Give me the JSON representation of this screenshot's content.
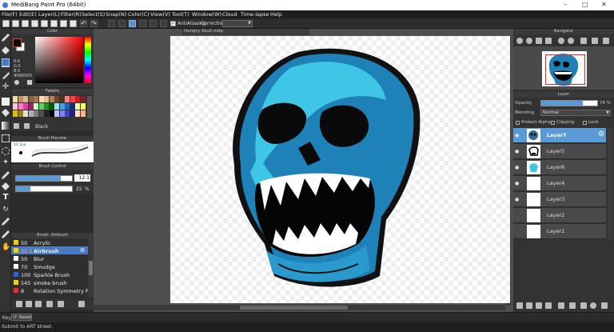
{
  "window": {
    "title": "MediBang Paint Pro (64bit)",
    "document_title": "Hungry Skull.mdp"
  },
  "menu": [
    "File(F)",
    "Edit(E)",
    "Layer(L)",
    "Filter(R)",
    "Select(S)",
    "Snap(N)",
    "Color(C)",
    "View(V)",
    "Tool(T)",
    "Window(W)",
    "Cloud",
    "Time-lapse",
    "Help"
  ],
  "toolbar": {
    "antialiasing_label": "AntiAliasing",
    "correction_label": "Correction"
  },
  "color_panel": {
    "title": "Color",
    "r": "R:6",
    "g": "G:5",
    "b": "B:5",
    "hex": "#060505",
    "foreground": "#060505",
    "background": "#ffffff"
  },
  "palette_panel": {
    "title": "Palette",
    "selected_name": "Black",
    "swatches": [
      "#f0e0a0",
      "#c09060",
      "#d8b898",
      "#8a6040",
      "#a07850",
      "#ffd8b0",
      "#e0c090",
      "#b08060",
      "#704828",
      "#503018",
      "#ff8080",
      "#ff4040",
      "#c02020",
      "#802020",
      "#ffc0e0",
      "#ff80c0",
      "#e040a0",
      "#a02070",
      "#c0ffc0",
      "#60d060",
      "#209020",
      "#006000",
      "#a0e0ff",
      "#40a0e0",
      "#2060c0",
      "#103080",
      "#ffffa0",
      "#ffff40",
      "#e0c000",
      "#a08000",
      "#e0e0e0",
      "#b0b0b0",
      "#808080",
      "#505050",
      "#202020",
      "#000000",
      "#c0c0ff",
      "#8080ff",
      "#4040c0",
      "#202080",
      "#ffe0c0",
      "#ffb080"
    ]
  },
  "brush_preview": {
    "title": "Brush Preview",
    "size_label": "12.1px"
  },
  "brush_control": {
    "title": "Brush Control",
    "size_value": "12.1",
    "opacity_value": "25",
    "opacity_unit": "%",
    "size_fraction": 0.8,
    "opacity_fraction": 0.25
  },
  "brush_list": {
    "title": "Brush: Airbrush",
    "items": [
      {
        "size": "50",
        "name": "Acrylic",
        "color": "#f5d000"
      },
      {
        "size": "12.1",
        "name": "Airbrush",
        "color": "#f5d000",
        "selected": true
      },
      {
        "size": "50",
        "name": "Blur",
        "color": "#ffffff"
      },
      {
        "size": "70",
        "name": "Smudge",
        "color": "#ffffff"
      },
      {
        "size": "100",
        "name": "Sparkle Brush",
        "color": "#3060e0"
      },
      {
        "size": "545",
        "name": "smoke brush",
        "color": "#f5d000"
      },
      {
        "size": "8",
        "name": "Rotation Symmetry Pen",
        "color": "#e03030"
      }
    ]
  },
  "navigator": {
    "title": "Navigator"
  },
  "layer_panel": {
    "title": "Layer",
    "opacity_label": "Opacity",
    "opacity_value": "74 %",
    "opacity_fraction": 0.74,
    "blending_label": "Blending",
    "blending_value": "Normal",
    "protect_alpha_label": "Protect Alpha",
    "clipping_label": "Clipping",
    "lock_label": "Lock",
    "layers": [
      {
        "name": "Layer7",
        "selected": true,
        "visible": true,
        "thumb": "skull-dark"
      },
      {
        "name": "Layer5",
        "selected": false,
        "visible": true,
        "thumb": "skull-black"
      },
      {
        "name": "Layer6",
        "selected": false,
        "visible": true,
        "thumb": "skull-cyan"
      },
      {
        "name": "Layer4",
        "selected": false,
        "visible": true,
        "thumb": "blank"
      },
      {
        "name": "Layer3",
        "selected": false,
        "visible": true,
        "thumb": "blank"
      },
      {
        "name": "Layer2",
        "selected": false,
        "visible": false,
        "thumb": "blank"
      },
      {
        "name": "Layer1",
        "selected": false,
        "visible": false,
        "thumb": "blank"
      }
    ]
  },
  "statusbar": {
    "key_label": "Key",
    "reset_label": "Reset",
    "submit_text": "Submit to ART street."
  },
  "colors": {
    "accent": "#4a7bc0",
    "skull_light": "#40c8e8",
    "skull_dark": "#1a7fb0"
  }
}
